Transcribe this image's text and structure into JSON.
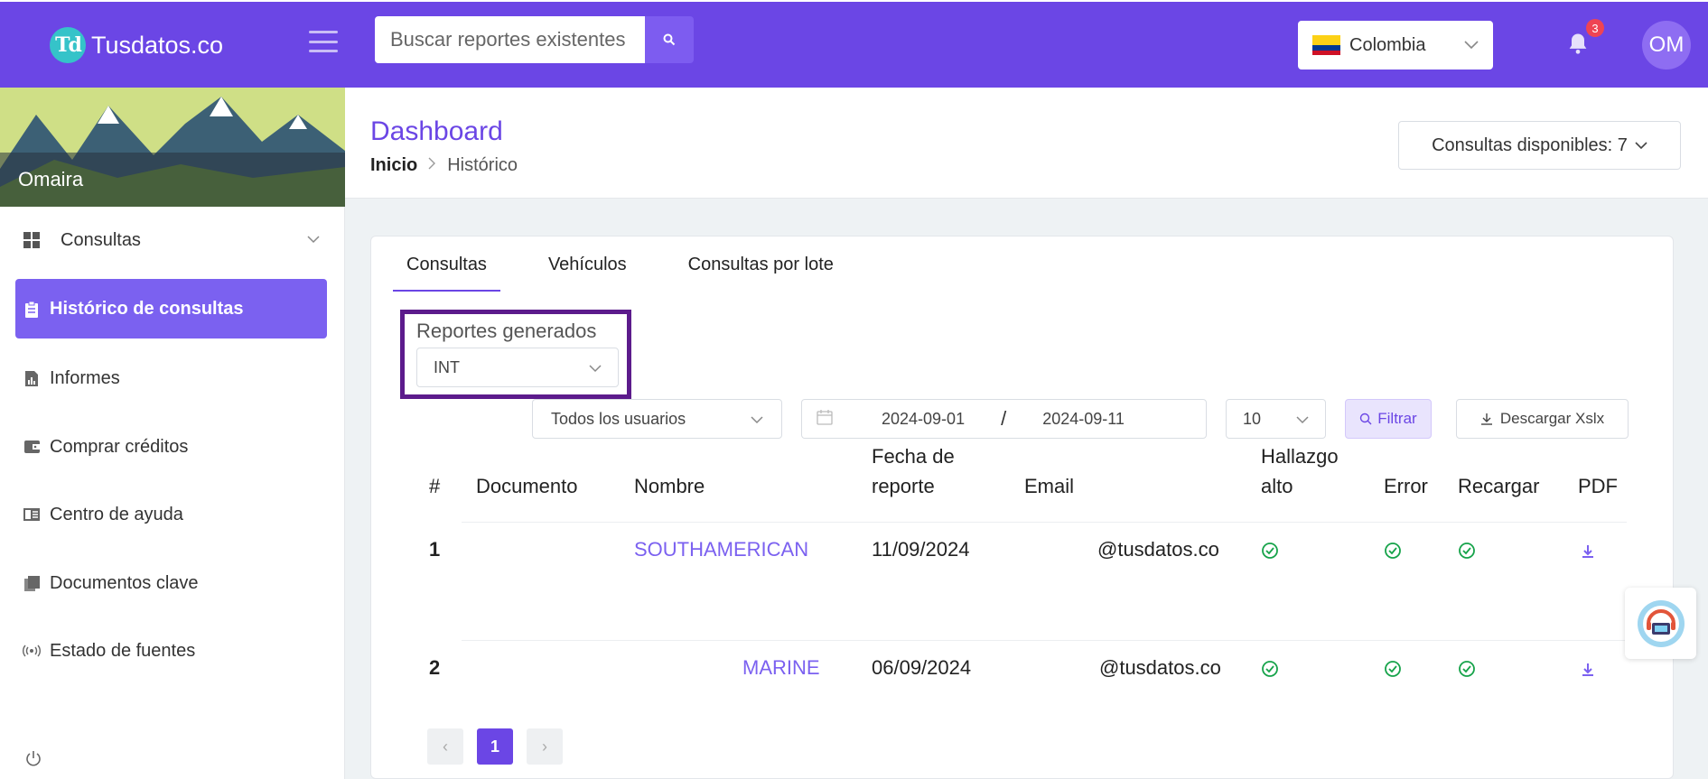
{
  "header": {
    "logo_mark": "Td",
    "logo_text": "Tusdatos.co",
    "search_placeholder": "Buscar reportes existentes",
    "country": "Colombia",
    "notification_count": "3",
    "avatar_initials": "OM",
    "colors": {
      "brand": "#6b46e5",
      "accent": "#7b61f0",
      "badge": "#ef4453"
    }
  },
  "sidebar": {
    "user_name": "Omaira",
    "items": [
      {
        "label": "Consultas",
        "icon": "grid-icon"
      },
      {
        "label": "Histórico de consultas",
        "icon": "clipboard-icon"
      },
      {
        "label": "Informes",
        "icon": "report-icon"
      },
      {
        "label": "Comprar créditos",
        "icon": "wallet-icon"
      },
      {
        "label": "Centro de ayuda",
        "icon": "book-icon"
      },
      {
        "label": "Documentos clave",
        "icon": "documents-icon"
      },
      {
        "label": "Estado de fuentes",
        "icon": "broadcast-icon"
      }
    ]
  },
  "page": {
    "title": "Dashboard",
    "breadcrumb_home": "Inicio",
    "breadcrumb_current": "Histórico",
    "credits": "Consultas disponibles: 7"
  },
  "tabs": [
    "Consultas",
    "Vehículos",
    "Consultas por lote"
  ],
  "reports": {
    "label": "Reportes generados",
    "selected": "INT"
  },
  "filters": {
    "users": "Todos los usuarios",
    "date_from": "2024-09-01",
    "date_sep": "/",
    "date_to": "2024-09-11",
    "page_size": "10",
    "filter_label": "Filtrar",
    "download_label": "Descargar Xslx"
  },
  "table": {
    "headers": {
      "num": "#",
      "documento": "Documento",
      "nombre": "Nombre",
      "fecha_1": "Fecha de",
      "fecha_2": "reporte",
      "email": "Email",
      "hallazgo_1": "Hallazgo",
      "hallazgo_2": "alto",
      "error": "Error",
      "recargar": "Recargar",
      "pdf": "PDF"
    },
    "rows": [
      {
        "num": "1",
        "nombre": "SOUTHAMERICAN",
        "fecha": "11/09/2024",
        "email": "@tusdatos.co"
      },
      {
        "num": "2",
        "nombre": "MARINE",
        "fecha": "06/09/2024",
        "email": "@tusdatos.co"
      }
    ]
  },
  "pagination": {
    "current": "1",
    "prev": "‹",
    "next": "›"
  }
}
